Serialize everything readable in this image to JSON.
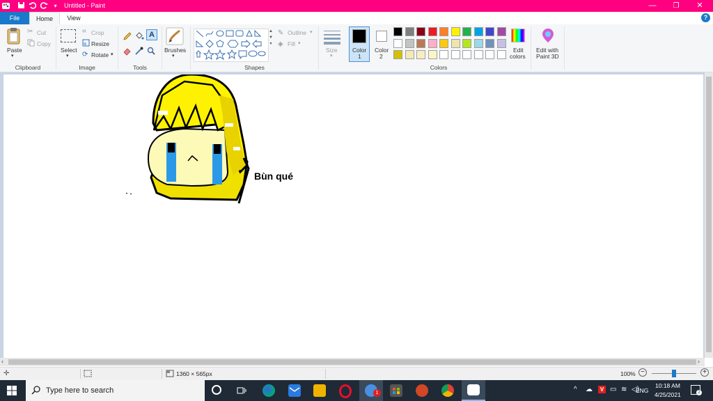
{
  "window": {
    "title": "Untitled - Paint",
    "minimize_glyph": "—",
    "maximize_glyph": "❐",
    "close_glyph": "✕"
  },
  "tabs": {
    "file": "File",
    "home": "Home",
    "view": "View",
    "help": "?"
  },
  "ribbon": {
    "clipboard": {
      "label": "Clipboard",
      "paste": "Paste",
      "cut": "Cut",
      "copy": "Copy"
    },
    "image": {
      "label": "Image",
      "select": "Select",
      "crop": "Crop",
      "resize": "Resize",
      "rotate": "Rotate"
    },
    "tools": {
      "label": "Tools"
    },
    "brushes": {
      "label": "Brushes"
    },
    "shapes": {
      "label": "Shapes",
      "outline": "Outline",
      "fill": "Fill"
    },
    "size": {
      "label": "Size"
    },
    "colors": {
      "label": "Colors",
      "color1_line1": "Color",
      "color1_line2": "1",
      "color2_line1": "Color",
      "color2_line2": "2",
      "edit_colors_line1": "Edit",
      "edit_colors_line2": "colors",
      "paint3d_line1": "Edit with",
      "paint3d_line2": "Paint 3D",
      "color1_value": "#000000",
      "color2_value": "#ffffff",
      "palette_row1": [
        "#000000",
        "#7f7f7f",
        "#880015",
        "#ed1c24",
        "#ff7f27",
        "#fff200",
        "#22b14c",
        "#00a2e8",
        "#3f48cc",
        "#a349a4"
      ],
      "palette_row2": [
        "#ffffff",
        "#c3c3c3",
        "#b97a57",
        "#ffaec9",
        "#ffc90e",
        "#efe4b0",
        "#b5e61d",
        "#99d9ea",
        "#7092be",
        "#c8bfe7"
      ],
      "palette_row3": [
        "#d4c000",
        "#f5e9b4",
        "#f8edc4",
        "#fbf5c8",
        "#ffffff",
        "#ffffff",
        "#ffffff",
        "#ffffff",
        "#ffffff",
        "#ffffff"
      ]
    }
  },
  "canvas": {
    "drawing_text": "Bùn qué"
  },
  "status": {
    "dimensions": "1360 × 565px",
    "zoom": "100%",
    "zoom_level_fraction": 0.5
  },
  "taskbar": {
    "search_placeholder": "Type here to search",
    "language": "ENG",
    "time": "10:18 AM",
    "date": "4/25/2021",
    "notification_count": "2",
    "chat_badge": "1"
  }
}
